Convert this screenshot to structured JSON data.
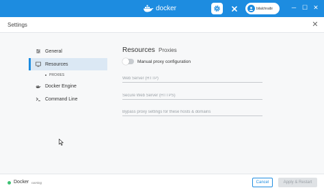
{
  "titlebar": {
    "brand_text": "docker",
    "user_name": "bilalchraibi",
    "icons": [
      "docker-whale-icon",
      "gear-icon",
      "tools-icon",
      "user-avatar-icon",
      "minimize-icon",
      "maximize-icon",
      "close-icon"
    ],
    "minimize": "─",
    "maximize": "☐",
    "close": "✕",
    "accent_color": "#1d8ce0"
  },
  "settings": {
    "title": "Settings",
    "close": "✕"
  },
  "sidebar": {
    "items": [
      {
        "label": "General",
        "icon": "sliders-icon"
      },
      {
        "label": "Resources",
        "icon": "monitor-icon",
        "active": true
      },
      {
        "label": "Docker Engine",
        "icon": "whale-icon"
      },
      {
        "label": "Command Line",
        "icon": "terminal-icon"
      }
    ],
    "sub_item": "PROXIES"
  },
  "content": {
    "title": "Resources",
    "subtitle": "Proxies",
    "toggle_label": "Manual proxy configuration",
    "toggle_on": false,
    "web_server_placeholder": "Web Server (HTTP)",
    "secure_web_server_placeholder": "Secure Web Server (HTTPS)",
    "bypass_placeholder": "Bypass proxy settings for these hosts & domains"
  },
  "footer": {
    "app_name": "Docker",
    "status": "running",
    "status_color": "#3cc172",
    "cancel_label": "Cancel",
    "apply_label": "Apply & Restart"
  }
}
